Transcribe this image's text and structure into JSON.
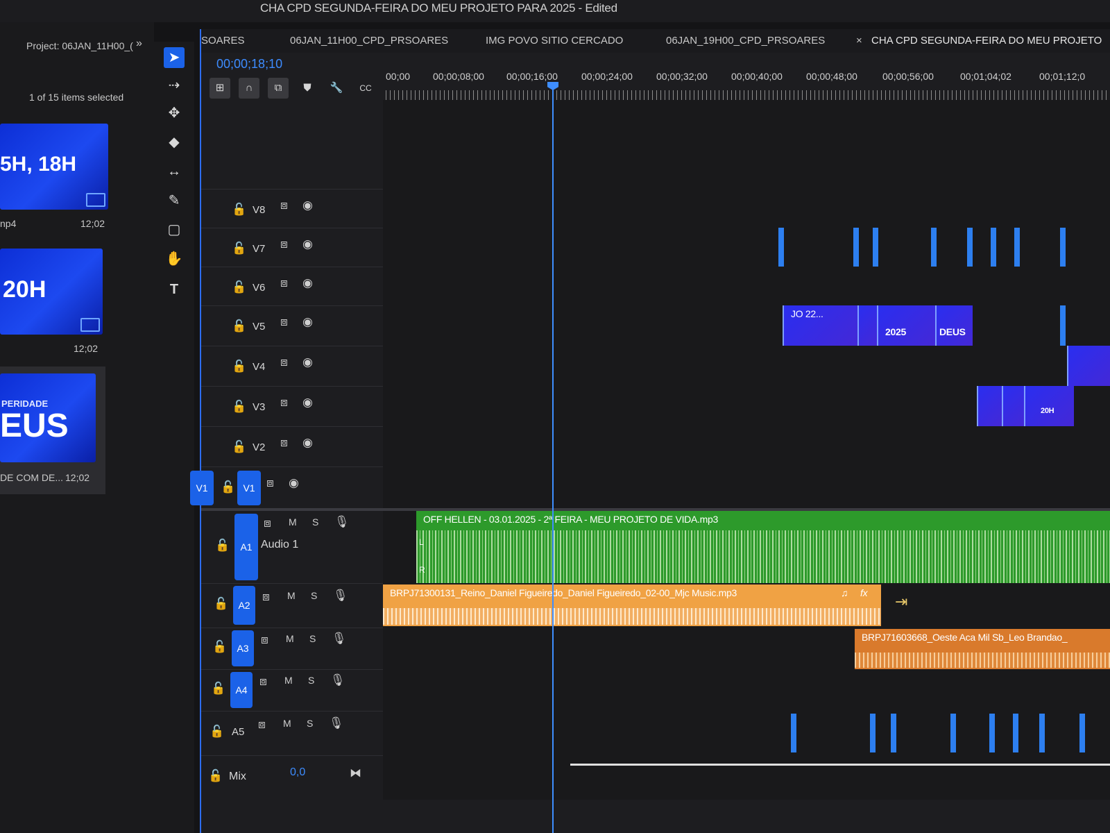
{
  "window": {
    "title": "CHA CPD SEGUNDA-FEIRA DO MEU PROJETO PARA 2025 - Edited"
  },
  "project_panel": {
    "title": "Project: 06JAN_11H00_(",
    "selection_status": "1 of 15 items selected",
    "items": [
      {
        "thumb_text": "5H, 18H",
        "name": "np4",
        "duration": "12;02"
      },
      {
        "thumb_text": "20H",
        "name": "",
        "duration": "12;02"
      },
      {
        "thumb_text": "EUS",
        "thumb_subtext": "PERIDADE",
        "name": "DE COM DE...",
        "duration": "12;02"
      }
    ]
  },
  "tools": [
    "selection-tool",
    "track-select-tool",
    "ripple-edit-tool",
    "razor-tool",
    "slip-tool",
    "pen-tool",
    "rectangle-tool",
    "hand-tool",
    "type-tool"
  ],
  "timeline": {
    "tabs": [
      "SOARES",
      "06JAN_11H00_CPD_PRSOARES",
      "IMG POVO SITIO CERCADO",
      "06JAN_19H00_CPD_PRSOARES",
      "CHA CPD SEGUNDA-FEIRA DO MEU PROJETO"
    ],
    "active_tab_index": 4,
    "timecode": "00;00;18;10",
    "ruler_labels": [
      "00;00",
      "00;00;08;00",
      "00;00;16;00",
      "00;00;24;00",
      "00;00;32;00",
      "00;00;40;00",
      "00;00;48;00",
      "00;00;56;00",
      "00;01;04;02",
      "00;01;12;0"
    ],
    "video_tracks": [
      "V8",
      "V7",
      "V6",
      "V5",
      "V4",
      "V3",
      "V2",
      "V1"
    ],
    "source_patch_v": "V1",
    "audio_tracks": [
      {
        "id": "A1",
        "name": "Audio 1"
      },
      {
        "id": "A2",
        "name": ""
      },
      {
        "id": "A3",
        "name": ""
      },
      {
        "id": "A4",
        "name": ""
      },
      {
        "id": "A5",
        "name": ""
      }
    ],
    "audio_buttons": {
      "mute": "M",
      "solo": "S"
    },
    "mix": {
      "label": "Mix",
      "value": "0,0"
    },
    "clips": {
      "a1": {
        "name": "OFF HELLEN - 03.01.2025 - 2ª FEIRA - MEU PROJETO DE VIDA.mp3",
        "channel_l": "L",
        "channel_r": "R"
      },
      "a2": {
        "name": "BRPJ71300131_Reino_Daniel Figueiredo_Daniel Figueiredo_02-00_Mjc Music.mp3"
      },
      "a3": {
        "name": "BRPJ71603668_Oeste Aca Mil Sb_Leo Brandao_"
      },
      "v5": {
        "name": "JO 22...",
        "thumb_texts": [
          "2025",
          "DEUS"
        ]
      },
      "v3": {
        "thumb_text": "20H"
      }
    },
    "colors": {
      "accent": "#1b62e8",
      "playhead": "#3e8eff",
      "audio_green": "#2d9a2b",
      "audio_orange": "#f0a244",
      "video_clip": "#2a2ef0",
      "work_area": "#e4d21c"
    }
  }
}
